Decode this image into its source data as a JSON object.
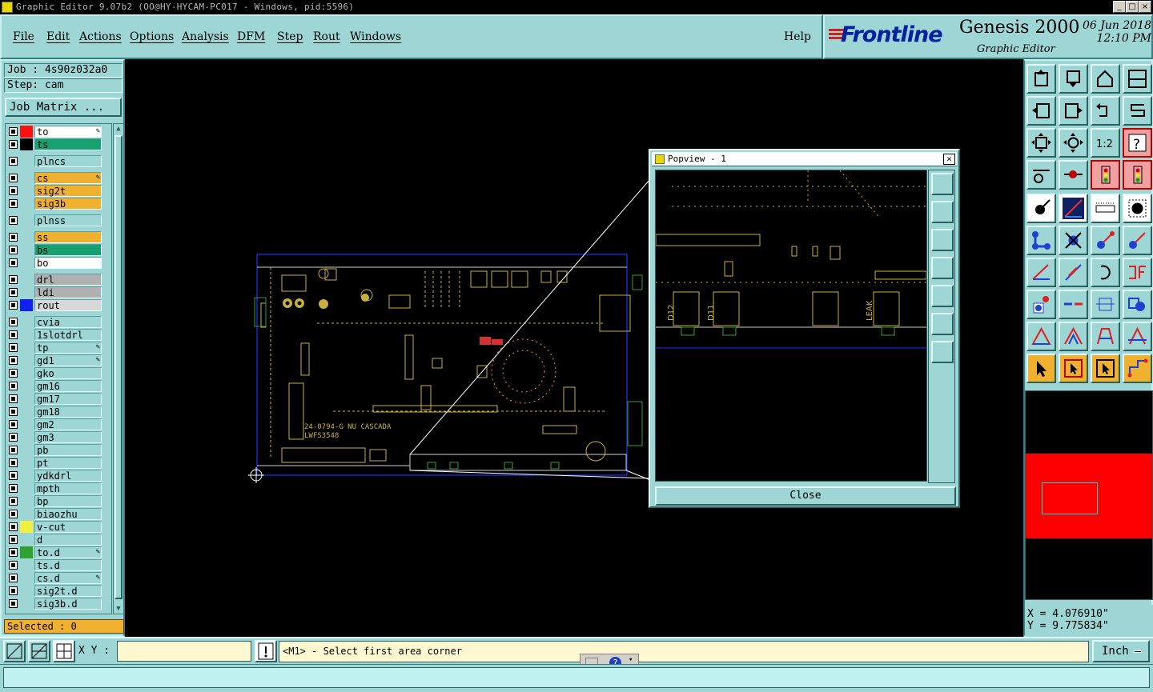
{
  "window": {
    "title": "Graphic Editor 9.07b2 (OO@HY-HYCAM-PC017 - Windows, pid:5596)"
  },
  "menu": {
    "items": [
      "File",
      "Edit",
      "Actions",
      "Options",
      "Analysis",
      "DFM",
      "Step",
      "Rout",
      "Windows"
    ],
    "help": "Help"
  },
  "brand": {
    "logo": "Frontline",
    "product": "Genesis 2000",
    "subtitle": "Graphic Editor",
    "date": "06 Jun 2018",
    "time": "12:10 PM"
  },
  "job": {
    "job_label": "Job : 4s90z032a0",
    "step_label": "Step: cam",
    "matrix_button": "Job Matrix ..."
  },
  "layers": [
    {
      "name": "to",
      "color": "#ff1010",
      "bg": "#ffffff",
      "mark": "✎"
    },
    {
      "name": "ts",
      "color": "#000000",
      "bg": "#18a070",
      "mark": ""
    },
    {
      "name": "plncs",
      "color": "",
      "bg": "#9ed6d6",
      "mark": "",
      "gap": true
    },
    {
      "name": "cs",
      "color": "",
      "bg": "#f0b030",
      "mark": "✎",
      "gap": true
    },
    {
      "name": "sig2t",
      "color": "",
      "bg": "#f0b030",
      "mark": ""
    },
    {
      "name": "sig3b",
      "color": "",
      "bg": "#f0b030",
      "mark": ""
    },
    {
      "name": "plnss",
      "color": "",
      "bg": "#9ed6d6",
      "mark": "",
      "gap": true
    },
    {
      "name": "ss",
      "color": "",
      "bg": "#f0b030",
      "mark": "",
      "gap": true
    },
    {
      "name": "bs",
      "color": "",
      "bg": "#18a070",
      "mark": ""
    },
    {
      "name": "bo",
      "color": "",
      "bg": "#ffffff",
      "mark": ""
    },
    {
      "name": "drl",
      "color": "",
      "bg": "#b0b0b0",
      "mark": "",
      "gap": true
    },
    {
      "name": "ldi",
      "color": "",
      "bg": "#b0b0b0",
      "mark": ""
    },
    {
      "name": "rout",
      "color": "#1020f0",
      "bg": "#d8d8d8",
      "mark": ""
    },
    {
      "name": "cvia",
      "color": "",
      "bg": "#9ed6d6",
      "mark": "",
      "gap": true
    },
    {
      "name": "1slotdrl",
      "color": "",
      "bg": "#9ed6d6",
      "mark": ""
    },
    {
      "name": "tp",
      "color": "",
      "bg": "#9ed6d6",
      "mark": "✎"
    },
    {
      "name": "gd1",
      "color": "",
      "bg": "#9ed6d6",
      "mark": "✎"
    },
    {
      "name": "gko",
      "color": "",
      "bg": "#9ed6d6",
      "mark": ""
    },
    {
      "name": "gm16",
      "color": "",
      "bg": "#9ed6d6",
      "mark": ""
    },
    {
      "name": "gm17",
      "color": "",
      "bg": "#9ed6d6",
      "mark": ""
    },
    {
      "name": "gm18",
      "color": "",
      "bg": "#9ed6d6",
      "mark": ""
    },
    {
      "name": "gm2",
      "color": "",
      "bg": "#9ed6d6",
      "mark": ""
    },
    {
      "name": "gm3",
      "color": "",
      "bg": "#9ed6d6",
      "mark": ""
    },
    {
      "name": "pb",
      "color": "",
      "bg": "#9ed6d6",
      "mark": ""
    },
    {
      "name": "pt",
      "color": "",
      "bg": "#9ed6d6",
      "mark": ""
    },
    {
      "name": "ydkdrl",
      "color": "",
      "bg": "#9ed6d6",
      "mark": ""
    },
    {
      "name": "mpth",
      "color": "",
      "bg": "#9ed6d6",
      "mark": ""
    },
    {
      "name": "bp",
      "color": "",
      "bg": "#9ed6d6",
      "mark": ""
    },
    {
      "name": "biaozhu",
      "color": "",
      "bg": "#9ed6d6",
      "mark": ""
    },
    {
      "name": "v-cut",
      "color": "#f0f040",
      "bg": "#9ed6d6",
      "mark": ""
    },
    {
      "name": "d",
      "color": "",
      "bg": "#9ed6d6",
      "mark": ""
    },
    {
      "name": "to.d",
      "color": "#30a030",
      "bg": "#9ed6d6",
      "mark": "✎"
    },
    {
      "name": "ts.d",
      "color": "",
      "bg": "#9ed6d6",
      "mark": ""
    },
    {
      "name": "cs.d",
      "color": "",
      "bg": "#9ed6d6",
      "mark": "✎"
    },
    {
      "name": "sig2t.d",
      "color": "",
      "bg": "#9ed6d6",
      "mark": ""
    },
    {
      "name": "sig3b.d",
      "color": "",
      "bg": "#9ed6d6",
      "mark": ""
    }
  ],
  "selected": "Selected : 0",
  "board": {
    "text1": "24-0794-G NU CASCADA",
    "text2": "LWFS3548"
  },
  "popview": {
    "title": "Popview - 1",
    "close_button": "Close",
    "labels": [
      "D12",
      "D11",
      "LEAK"
    ]
  },
  "coords": {
    "x": "X = 4.076910\"",
    "y": "Y = 9.775834\""
  },
  "bottom": {
    "xy_label": "X Y :",
    "xy_value": "",
    "prompt": "<M1> - Select first area corner",
    "unit": "Inch"
  }
}
